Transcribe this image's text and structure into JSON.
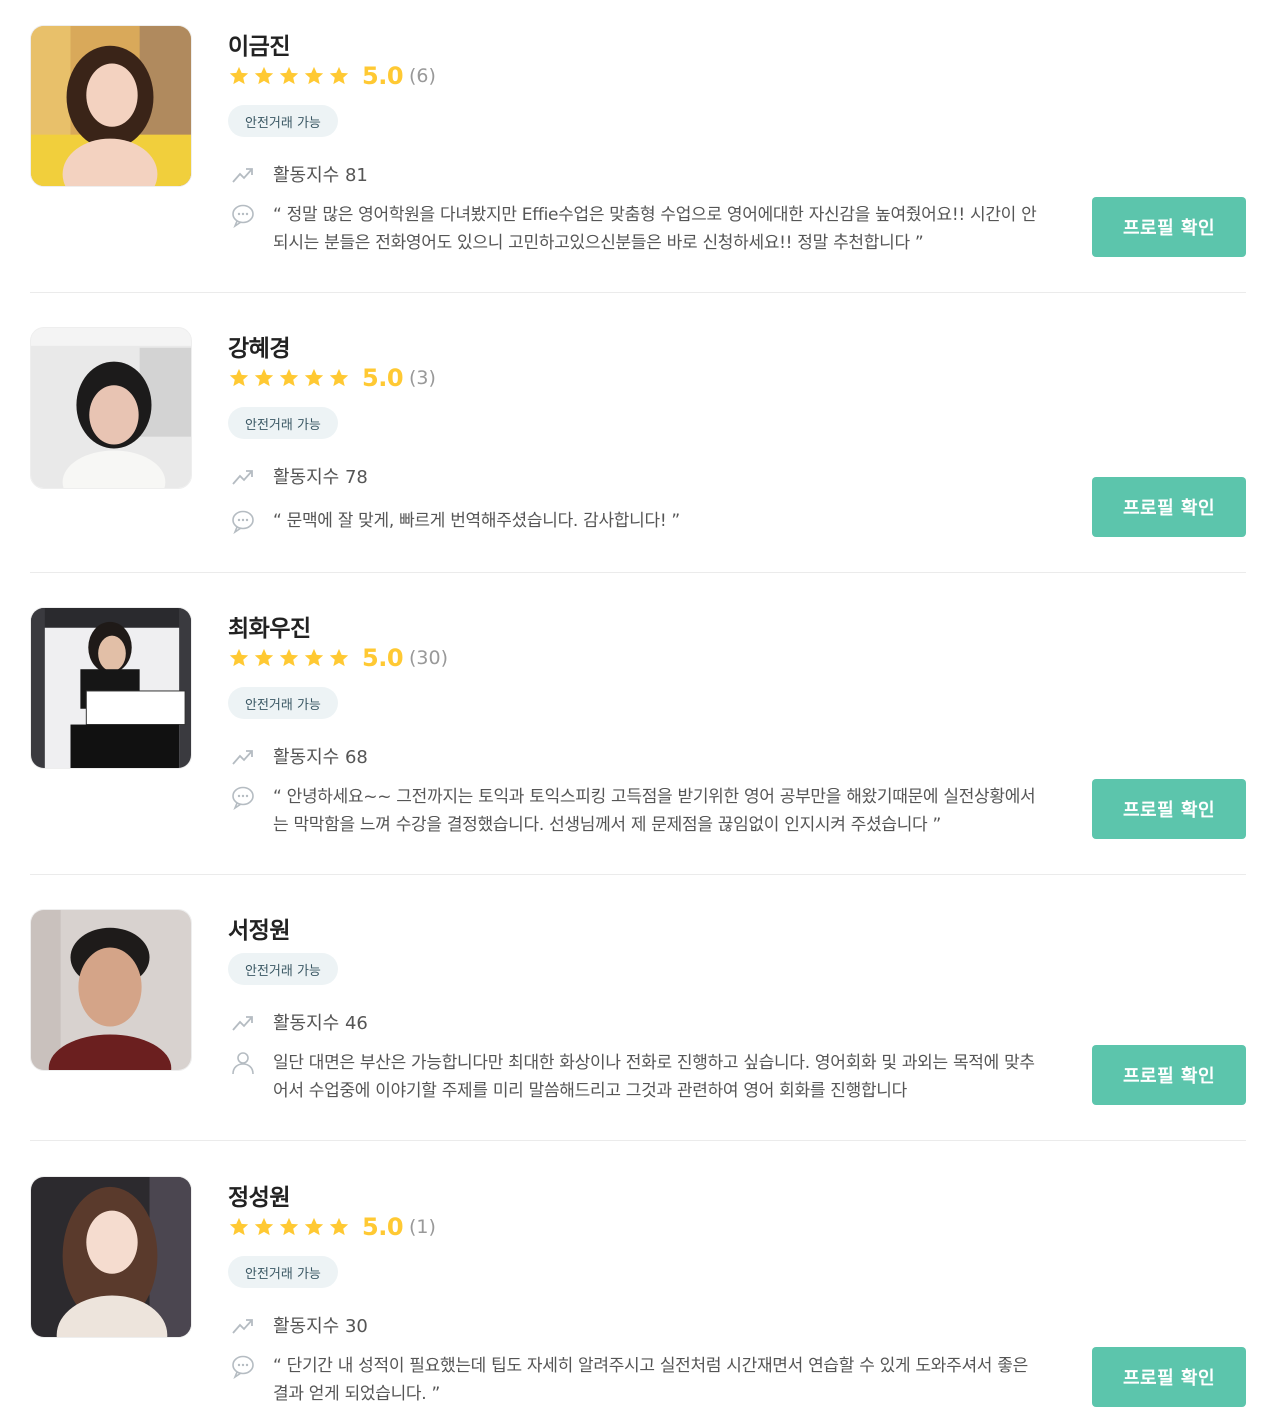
{
  "profiles": [
    {
      "name": "이금진",
      "score": "5.0",
      "count": "(6)",
      "badge": "안전거래 가능",
      "activity": "활동지수 81",
      "review_icon": "chat-icon",
      "review": "“ 정말 많은 영어학원을 다녀봤지만 Effie수업은 맞춤형 수업으로 영어에대한 자신감을 높여줬어요!! 시간이 안되시는 분들은 전화영어도 있으니 고민하고있으신분들은 바로 신청하세요!! 정말 추천합니다 ”",
      "button": "프로필 확인"
    },
    {
      "name": "강혜경",
      "score": "5.0",
      "count": "(3)",
      "badge": "안전거래 가능",
      "activity": "활동지수 78",
      "review_icon": "chat-icon",
      "review": "“ 문맥에 잘 맞게, 빠르게 번역해주셨습니다. 감사합니다! ”",
      "button": "프로필 확인"
    },
    {
      "name": "최화우진",
      "score": "5.0",
      "count": "(30)",
      "badge": "안전거래 가능",
      "activity": "활동지수 68",
      "review_icon": "chat-icon",
      "review": "“ 안녕하세요~~ 그전까지는 토익과 토익스피킹 고득점을 받기위한 영어 공부만을 해왔기때문에 실전상황에서는 막막함을 느껴 수강을 결정했습니다. 선생님께서 제 문제점을 끊임없이 인지시켜 주셨습니다 ”",
      "button": "프로필 확인"
    },
    {
      "name": "서정원",
      "score": "",
      "count": "",
      "badge": "안전거래 가능",
      "activity": "활동지수 46",
      "review_icon": "person-icon",
      "review": "일단 대면은 부산은 가능합니다만 최대한 화상이나 전화로 진행하고 싶습니다. 영어회화 및 과외는 목적에 맞추어서 수업중에 이야기할 주제를 미리 말씀해드리고 그것과 관련하여 영어 회화를 진행합니다",
      "button": "프로필 확인"
    },
    {
      "name": "정성원",
      "score": "5.0",
      "count": "(1)",
      "badge": "안전거래 가능",
      "activity": "활동지수 30",
      "review_icon": "chat-icon",
      "review": "“ 단기간 내 성적이 필요했는데 팁도 자세히 알려주시고 실전처럼 시간재면서 연습할 수 있게 도와주셔서 좋은결과 얻게 되었습니다. ”",
      "button": "프로필 확인"
    }
  ],
  "colors": {
    "star": "#ffc933",
    "button": "#5cc5ac",
    "badge_bg": "#edf3f5"
  }
}
